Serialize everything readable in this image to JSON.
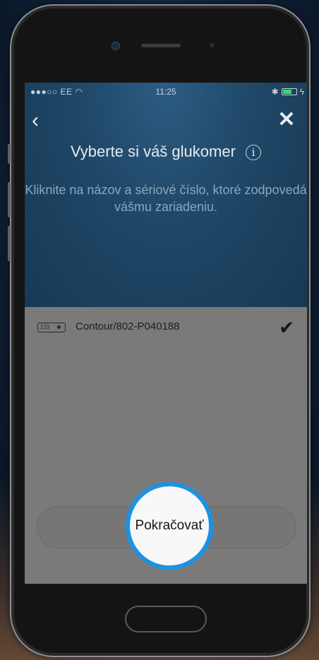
{
  "status_bar": {
    "carrier": "●●●○○ EE",
    "time": "11:25"
  },
  "header": {
    "back_icon": "chevron-left-icon",
    "close_icon": "close-icon",
    "title": "Vyberte si váš glukomer",
    "info_icon": "info-icon",
    "info_glyph": "i",
    "subtitle": "Kliknite na názov a sériové číslo, ktoré zodpovedá vášmu zariadeniu."
  },
  "device_list": [
    {
      "icon_label": "123",
      "name": "Contour/802-P040188",
      "selected": true
    }
  ],
  "continue_button": {
    "label": "Pokračovať"
  },
  "colors": {
    "accent": "#1a92e6",
    "battery": "#2ee06a"
  }
}
